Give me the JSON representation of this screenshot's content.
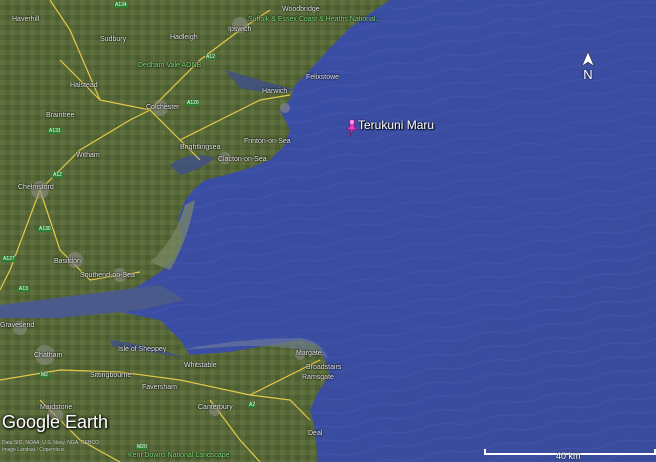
{
  "marker": {
    "label": "Terukuni Maru"
  },
  "compass": {
    "label": "N"
  },
  "branding": {
    "logo": "Google Earth"
  },
  "credits": {
    "line1": "Data SIO, NOAA, U.S. Navy, NGA, GEBCO",
    "line2": "Image Landsat / Copernicus"
  },
  "scale": {
    "label": "40 km"
  },
  "places": {
    "haverhill": "Haverhill",
    "sudbury": "Sudbury",
    "hadleigh": "Hadleigh",
    "ipswich": "Ipswich",
    "woodbridge": "Woodbridge",
    "suffolk_coast": "Suffolk & Essex Coast & Heaths National...",
    "dedham": "Dedham Vale AONB",
    "halstead": "Halstead",
    "felixstowe": "Felixstowe",
    "harwich": "Harwich",
    "colchester": "Colchester",
    "braintree": "Braintree",
    "frinton": "Frinton-on-Sea",
    "brightlingsea": "Brightlingsea",
    "clacton": "Clacton-on-Sea",
    "witham": "Witham",
    "chelmsford": "Chelmsford",
    "basildon": "Basildon",
    "southend": "Southend-on-Sea",
    "gravesend": "Gravesend",
    "sheppey": "Isle of Sheppey",
    "chatham": "Chatham",
    "margate": "Margate",
    "whitstable": "Whitstable",
    "broadstairs": "Broadstairs",
    "ramsgate": "Ramsgate",
    "sittingbourne": "Sittingbourne",
    "faversham": "Faversham",
    "maidstone": "Maidstone",
    "canterbury": "Canterbury",
    "deal": "Deal",
    "kent_downs": "Kent Downs National Landscape"
  },
  "roads": {
    "a134": "A134",
    "a12": "A12",
    "a120": "A120",
    "a131": "A131",
    "a130": "A130",
    "a127": "A127",
    "a13": "A13",
    "m2": "M2",
    "m20": "M20",
    "a2": "A2"
  },
  "colors": {
    "sea": "#3d52a8",
    "land": "#5a6b3c",
    "roads": "#f2d44a",
    "pin": "#e040c8"
  }
}
